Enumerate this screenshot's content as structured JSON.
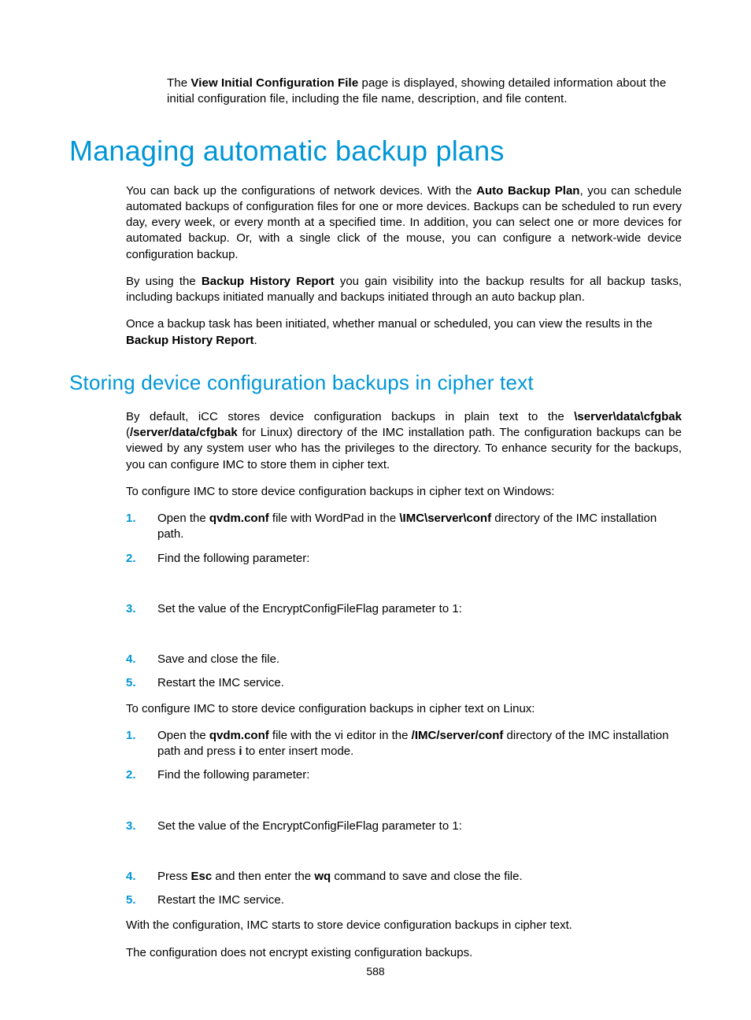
{
  "intro": {
    "pre": "The ",
    "bold": "View Initial Configuration File",
    "post": " page is displayed, showing detailed information about the initial configuration file, including the file name, description, and file content."
  },
  "h1": "Managing automatic backup plans",
  "p1": {
    "pre": "You can back up the configurations of network devices. With the ",
    "bold": "Auto Backup Plan",
    "post": ", you can schedule automated backups of configuration files for one or more devices. Backups can be scheduled to run every day, every week, or every month at a specified time. In addition, you can select one or more devices for automated backup. Or, with a single click of the mouse, you can configure a network-wide device configuration backup."
  },
  "p2": {
    "pre": "By using the ",
    "bold": "Backup History Report",
    "post": " you gain visibility into the backup results for all backup tasks, including backups initiated manually and backups initiated through an auto backup plan."
  },
  "p3": {
    "pre": "Once a backup task has been initiated, whether manual or scheduled, you can view the results in the ",
    "bold": "Backup History Report",
    "post": "."
  },
  "h2": "Storing device configuration backups in cipher text",
  "p4": {
    "a": "By default, iCC stores device configuration backups in plain text to the ",
    "b": "\\server\\data\\cfgbak",
    "c": " (",
    "d": "/server/data/cfgbak",
    "e": " for Linux) directory of the IMC installation path. The configuration backups can be viewed by any system user who has the privileges to the directory. To enhance security for the backups, you can configure IMC to store them in cipher text."
  },
  "p5": "To configure IMC to store device configuration backups in cipher text on Windows:",
  "win": {
    "s1": {
      "a": "Open the ",
      "b": "qvdm.conf",
      "c": " file with WordPad in the ",
      "d": "\\IMC\\server\\conf",
      "e": " directory of the IMC installation path."
    },
    "s2": "Find the following parameter:",
    "s3": "Set the value of the EncryptConfigFileFlag parameter to 1:",
    "s4": "Save and close the file.",
    "s5": "Restart the IMC service."
  },
  "p6": "To configure IMC to store device configuration backups in cipher text on Linux:",
  "lin": {
    "s1": {
      "a": "Open the ",
      "b": "qvdm.conf",
      "c": " file with the vi editor in the ",
      "d": "/IMC/server/conf",
      "e": " directory of the IMC installation path and press ",
      "f": "i",
      "g": " to enter insert mode."
    },
    "s2": "Find the following parameter:",
    "s3": "Set the value of the EncryptConfigFileFlag parameter to 1:",
    "s4": {
      "a": "Press ",
      "b": "Esc",
      "c": " and then enter the ",
      "d": "wq",
      "e": " command to save and close the file."
    },
    "s5": "Restart the IMC service."
  },
  "p7": "With the configuration, IMC starts to store device configuration backups in cipher text.",
  "p8": "The configuration does not encrypt existing configuration backups.",
  "pageNumber": "588",
  "nums": {
    "n1": "1.",
    "n2": "2.",
    "n3": "3.",
    "n4": "4.",
    "n5": "5."
  }
}
